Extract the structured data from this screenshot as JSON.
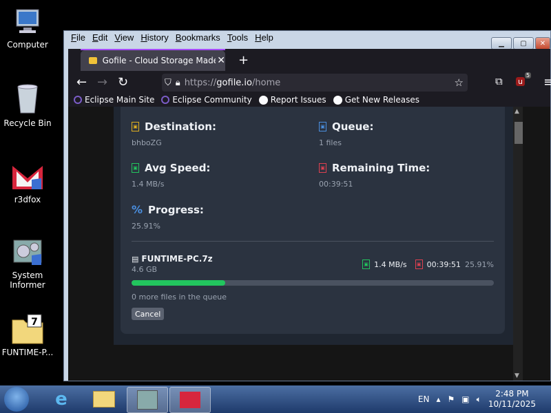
{
  "desktop": {
    "icons": [
      {
        "label": "Computer"
      },
      {
        "label": "Recycle Bin"
      },
      {
        "label": "r3dfox"
      },
      {
        "label": "System\nInformer"
      },
      {
        "label": "FUNTIME-P..."
      }
    ]
  },
  "window": {
    "menu": [
      "File",
      "Edit",
      "View",
      "History",
      "Bookmarks",
      "Tools",
      "Help"
    ],
    "tab_title": "Gofile - Cloud Storage Made Sir",
    "url": {
      "proto": "https://",
      "host": "gofile.io",
      "path": "/home"
    },
    "ublock_badge": "5",
    "bookmarks": [
      "Eclipse Main Site",
      "Eclipse Community",
      "Report Issues",
      "Get New Releases"
    ]
  },
  "upload": {
    "destination": {
      "label": "Destination:",
      "value": "bhboZG"
    },
    "queue": {
      "label": "Queue:",
      "value": "1 files"
    },
    "avg_speed": {
      "label": "Avg Speed:",
      "value": "1.4 MB/s"
    },
    "remaining": {
      "label": "Remaining Time:",
      "value": "00:39:51"
    },
    "progress": {
      "label": "Progress:",
      "value": "25.91%",
      "fraction": 0.2591
    },
    "file": {
      "name": "FUNTIME-PC.7z",
      "size": "4.6 GB",
      "speed": "1.4 MB/s",
      "time": "00:39:51",
      "percent": "25.91%"
    },
    "queue_text": "0 more files in the queue",
    "cancel_label": "Cancel"
  },
  "taskbar": {
    "lang": "EN",
    "time": "2:48 PM",
    "date": "10/11/2025"
  },
  "colors": {
    "progress_green": "#22c55e",
    "card_bg": "#2b3340",
    "firefox_purple": "#a74cff"
  }
}
